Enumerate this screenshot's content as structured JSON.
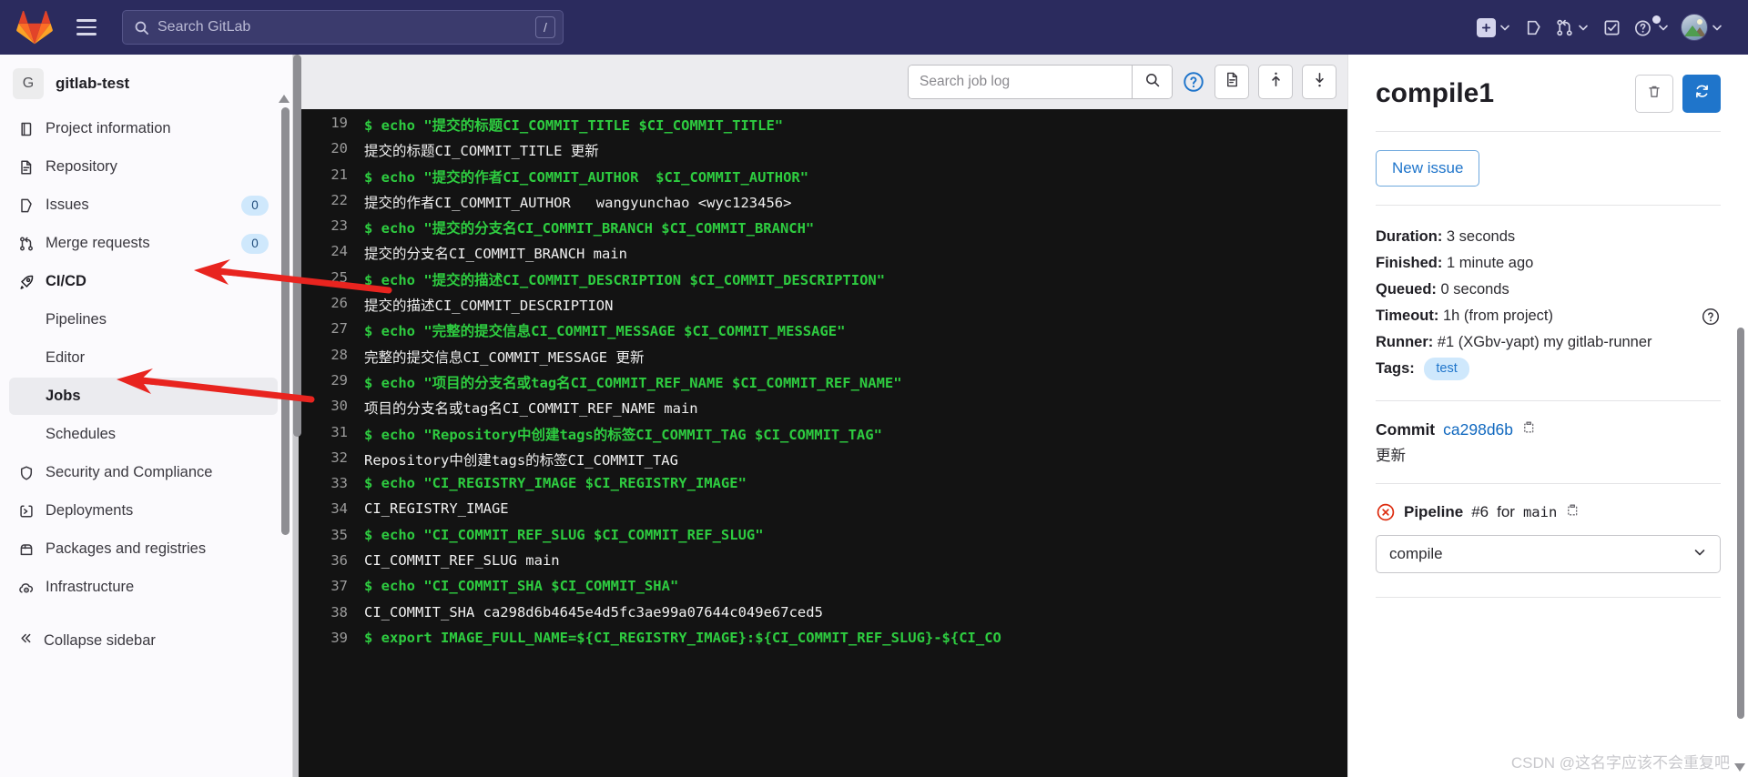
{
  "topnav": {
    "logo_icon": "gitlab-tanuki-logo",
    "menu_icon": "hamburger-menu-icon",
    "search": {
      "placeholder": "Search GitLab",
      "value": "",
      "shortcut_key": "/",
      "icon": "search-icon"
    },
    "actions": [
      {
        "name": "create-new-menu",
        "icon": "plus-square-icon",
        "has_chevron": true
      },
      {
        "name": "issues-link",
        "icon": "issues-icon",
        "has_chevron": false
      },
      {
        "name": "merge-requests-menu",
        "icon": "merge-request-icon",
        "has_chevron": true
      },
      {
        "name": "todos-link",
        "icon": "todo-checkbox-icon",
        "has_chevron": false
      },
      {
        "name": "help-menu",
        "icon": "help-circle-icon",
        "has_chevron": true
      },
      {
        "name": "user-menu",
        "icon": "avatar",
        "has_chevron": true
      }
    ]
  },
  "sidebar": {
    "project": {
      "initial": "G",
      "name": "gitlab-test"
    },
    "items": [
      {
        "label": "Project information",
        "icon": "project-information-icon",
        "badge": "",
        "level": "top",
        "active": false
      },
      {
        "label": "Repository",
        "icon": "repository-icon",
        "badge": "",
        "level": "top",
        "active": false
      },
      {
        "label": "Issues",
        "icon": "issues-icon",
        "badge": "0",
        "level": "top",
        "active": false
      },
      {
        "label": "Merge requests",
        "icon": "merge-request-icon",
        "badge": "0",
        "level": "top",
        "active": false
      },
      {
        "label": "CI/CD",
        "icon": "rocket-icon",
        "badge": "",
        "level": "top",
        "active": false,
        "bold": true
      },
      {
        "label": "Pipelines",
        "icon": "",
        "badge": "",
        "level": "sub",
        "active": false
      },
      {
        "label": "Editor",
        "icon": "",
        "badge": "",
        "level": "sub",
        "active": false
      },
      {
        "label": "Jobs",
        "icon": "",
        "badge": "",
        "level": "sub",
        "active": true
      },
      {
        "label": "Schedules",
        "icon": "",
        "badge": "",
        "level": "sub",
        "active": false
      },
      {
        "label": "Security and Compliance",
        "icon": "shield-icon",
        "badge": "",
        "level": "top",
        "active": false
      },
      {
        "label": "Deployments",
        "icon": "deployments-icon",
        "badge": "",
        "level": "top",
        "active": false
      },
      {
        "label": "Packages and registries",
        "icon": "package-icon",
        "badge": "",
        "level": "top",
        "active": false
      },
      {
        "label": "Infrastructure",
        "icon": "cloud-gear-icon",
        "badge": "",
        "level": "top",
        "active": false
      }
    ],
    "collapse_label": "Collapse sidebar",
    "collapse_icon": "double-chevron-left-icon"
  },
  "log_toolbar": {
    "search": {
      "placeholder": "Search job log",
      "value": ""
    },
    "search_button_icon": "search-icon",
    "help_icon": "help-circle-icon",
    "raw_icon": "raw-document-icon",
    "scroll_top_icon": "scroll-to-top-icon",
    "scroll_bottom_icon": "scroll-to-bottom-icon"
  },
  "job_log": {
    "lines": [
      {
        "n": "19",
        "cmd": true,
        "text": "$ echo \"提交的标题CI_COMMIT_TITLE $CI_COMMIT_TITLE\""
      },
      {
        "n": "20",
        "cmd": false,
        "text": "提交的标题CI_COMMIT_TITLE 更新"
      },
      {
        "n": "21",
        "cmd": true,
        "text": "$ echo \"提交的作者CI_COMMIT_AUTHOR  $CI_COMMIT_AUTHOR\""
      },
      {
        "n": "22",
        "cmd": false,
        "text": "提交的作者CI_COMMIT_AUTHOR   wangyunchao <wyc123456>"
      },
      {
        "n": "23",
        "cmd": true,
        "text": "$ echo \"提交的分支名CI_COMMIT_BRANCH $CI_COMMIT_BRANCH\""
      },
      {
        "n": "24",
        "cmd": false,
        "text": "提交的分支名CI_COMMIT_BRANCH main"
      },
      {
        "n": "25",
        "cmd": true,
        "text": "$ echo \"提交的描述CI_COMMIT_DESCRIPTION $CI_COMMIT_DESCRIPTION\""
      },
      {
        "n": "26",
        "cmd": false,
        "text": "提交的描述CI_COMMIT_DESCRIPTION"
      },
      {
        "n": "27",
        "cmd": true,
        "text": "$ echo \"完整的提交信息CI_COMMIT_MESSAGE $CI_COMMIT_MESSAGE\""
      },
      {
        "n": "28",
        "cmd": false,
        "text": "完整的提交信息CI_COMMIT_MESSAGE 更新"
      },
      {
        "n": "29",
        "cmd": true,
        "text": "$ echo \"项目的分支名或tag名CI_COMMIT_REF_NAME $CI_COMMIT_REF_NAME\""
      },
      {
        "n": "30",
        "cmd": false,
        "text": "项目的分支名或tag名CI_COMMIT_REF_NAME main"
      },
      {
        "n": "31",
        "cmd": true,
        "text": "$ echo \"Repository中创建tags的标签CI_COMMIT_TAG $CI_COMMIT_TAG\""
      },
      {
        "n": "32",
        "cmd": false,
        "text": "Repository中创建tags的标签CI_COMMIT_TAG"
      },
      {
        "n": "33",
        "cmd": true,
        "text": "$ echo \"CI_REGISTRY_IMAGE $CI_REGISTRY_IMAGE\""
      },
      {
        "n": "34",
        "cmd": false,
        "text": "CI_REGISTRY_IMAGE"
      },
      {
        "n": "35",
        "cmd": true,
        "text": "$ echo \"CI_COMMIT_REF_SLUG $CI_COMMIT_REF_SLUG\""
      },
      {
        "n": "36",
        "cmd": false,
        "text": "CI_COMMIT_REF_SLUG main"
      },
      {
        "n": "37",
        "cmd": true,
        "text": "$ echo \"CI_COMMIT_SHA $CI_COMMIT_SHA\""
      },
      {
        "n": "38",
        "cmd": false,
        "text": "CI_COMMIT_SHA ca298d6b4645e4d5fc3ae99a07644c049e67ced5"
      },
      {
        "n": "39",
        "cmd": true,
        "text": "$ export IMAGE_FULL_NAME=${CI_REGISTRY_IMAGE}:${CI_COMMIT_REF_SLUG}-${CI_CO"
      }
    ]
  },
  "job_panel": {
    "title": "compile1",
    "erase_icon": "trash-icon",
    "retry_icon": "retry-refresh-icon",
    "new_issue_label": "New issue",
    "details": [
      {
        "key": "Duration:",
        "value": "3 seconds",
        "help": false
      },
      {
        "key": "Finished:",
        "value": "1 minute ago",
        "help": false
      },
      {
        "key": "Queued:",
        "value": "0 seconds",
        "help": false
      },
      {
        "key": "Timeout:",
        "value": "1h (from project)",
        "help": true
      },
      {
        "key": "Runner:",
        "value": "#1 (XGbv-yapt) my gitlab-runner",
        "help": false
      }
    ],
    "tags_label": "Tags:",
    "tags": [
      "test"
    ],
    "commit_label": "Commit",
    "commit_sha": "ca298d6b",
    "commit_copy_icon": "copy-icon",
    "commit_message": "更新",
    "pipeline_status_icon": "pipeline-failed-icon",
    "pipeline_label": "Pipeline",
    "pipeline_number": "#6",
    "pipeline_for": "for",
    "pipeline_ref": "main",
    "pipeline_copy_icon": "copy-icon",
    "stage_select": {
      "value": "compile",
      "chevron_icon": "chevron-down-icon"
    }
  },
  "watermark": "CSDN @这名字应该不会重复吧",
  "colors": {
    "nav_bg": "#2b2b5e",
    "accent_blue": "#1f75cb",
    "log_bg": "#131313",
    "log_cmd_green": "#2ecc40",
    "annotation_red": "#e8241f"
  }
}
